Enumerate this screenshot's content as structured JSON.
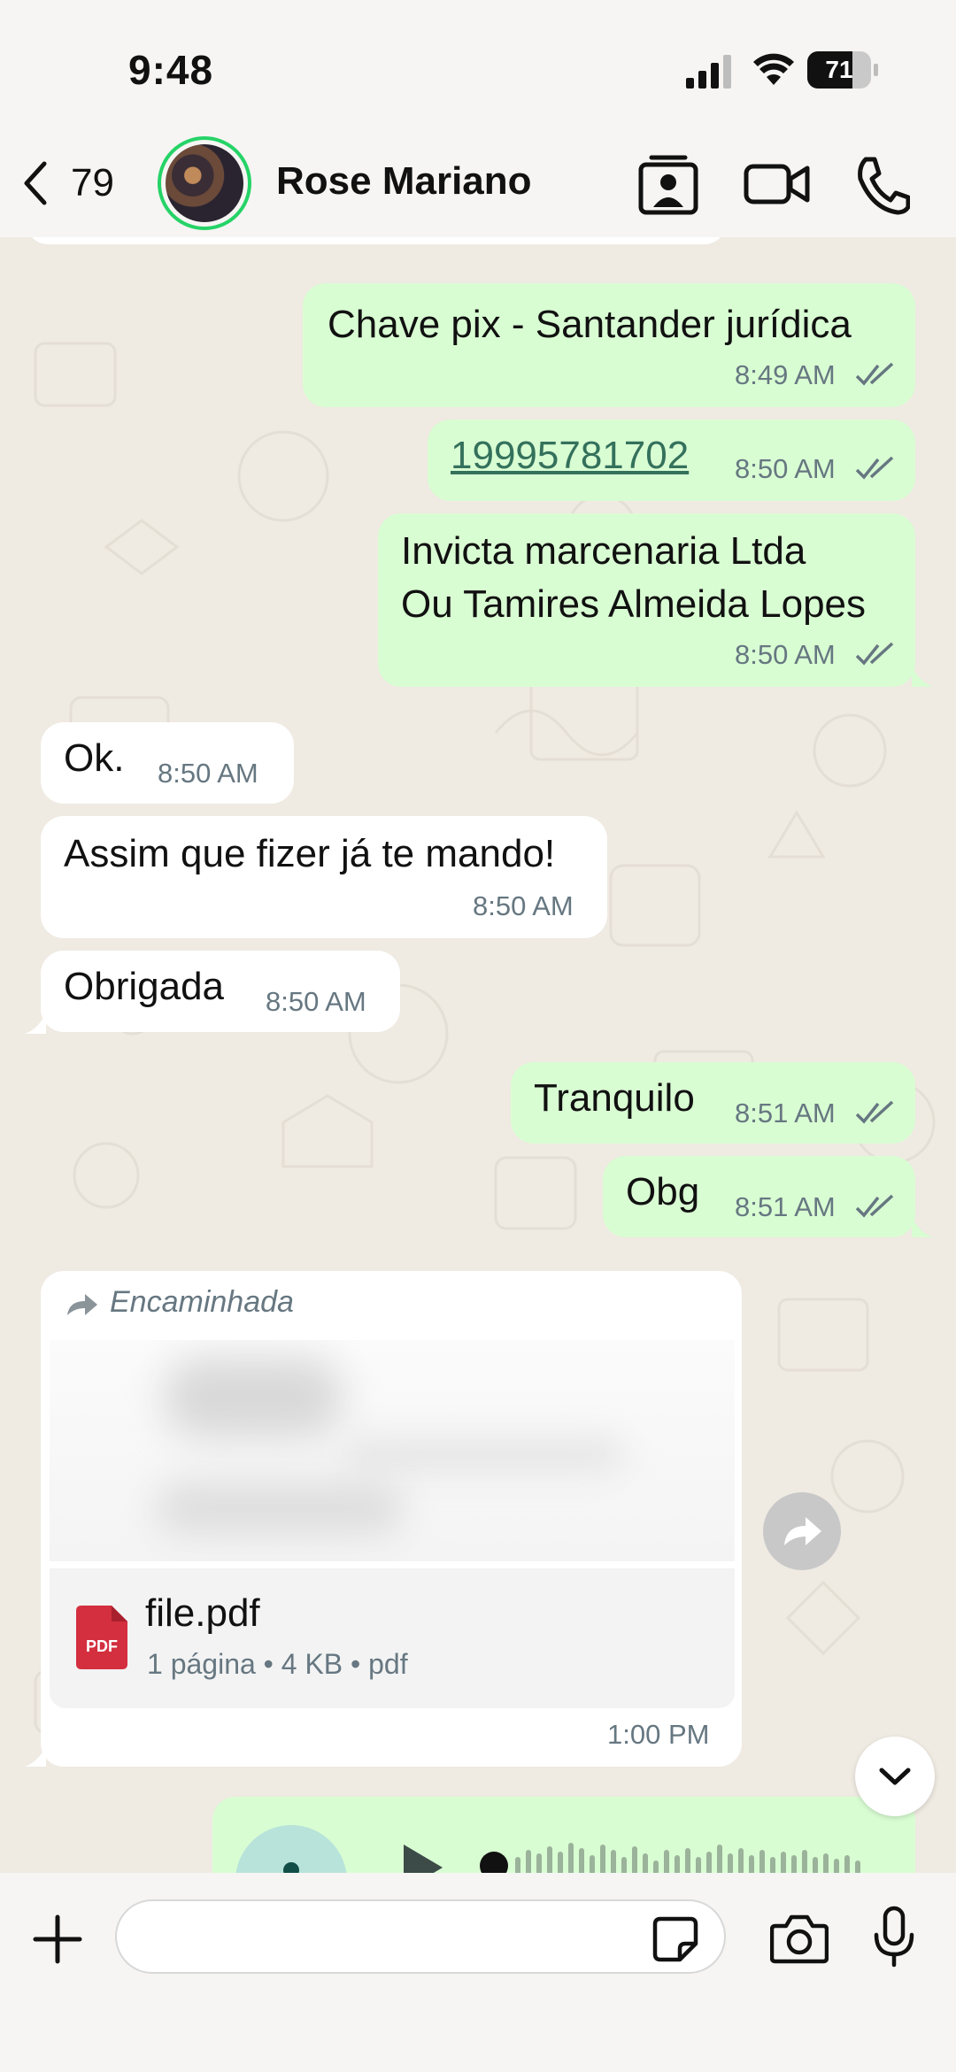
{
  "status_bar": {
    "time": "9:48",
    "battery_level": "71",
    "battery_fraction": 0.71,
    "icons": [
      "cellular-signal-icon",
      "wifi-icon",
      "battery-icon"
    ]
  },
  "header": {
    "back_count": "79",
    "contact_name": "Rose Mariano",
    "icons": [
      "chevron-left-icon",
      "contact-card-icon",
      "video-call-icon",
      "phone-icon"
    ],
    "accent_color": "#25d366"
  },
  "messages": [
    {
      "id": "m1",
      "direction": "outgoing",
      "text": "Chave pix -  Santander jurídica",
      "time": "8:49 AM",
      "read": true
    },
    {
      "id": "m2",
      "direction": "outgoing",
      "text": "19995781702",
      "time": "8:50 AM",
      "read": true,
      "is_link": true
    },
    {
      "id": "m3",
      "direction": "outgoing",
      "lines": [
        "Invicta marcenaria Ltda",
        "Ou Tamires Almeida Lopes"
      ],
      "time": "8:50 AM",
      "read": true
    },
    {
      "id": "m4",
      "direction": "incoming",
      "text": "Ok.",
      "time": "8:50 AM"
    },
    {
      "id": "m5",
      "direction": "incoming",
      "text": "Assim que fizer já te mando!",
      "time": "8:50 AM"
    },
    {
      "id": "m6",
      "direction": "incoming",
      "text": "Obrigada",
      "time": "8:50 AM"
    },
    {
      "id": "m7",
      "direction": "outgoing",
      "text": "Tranquilo",
      "time": "8:51 AM",
      "read": true
    },
    {
      "id": "m8",
      "direction": "outgoing",
      "text": "Obg",
      "time": "8:51 AM",
      "read": true
    },
    {
      "id": "m9",
      "direction": "incoming",
      "forwarded_label": "Encaminhada",
      "file": {
        "name": "file.pdf",
        "meta": "1 página • 4 KB • pdf",
        "type_badge": "PDF"
      },
      "time": "1:00 PM"
    }
  ],
  "colors": {
    "outgoing_bubble": "#d9fdd3",
    "incoming_bubble": "#ffffff",
    "chat_background": "#efeae2",
    "link": "#34715c",
    "read_ticks": "#667781",
    "pdf_red": "#d32f3f"
  },
  "input_bar": {
    "placeholder": "",
    "icons": [
      "plus-icon",
      "sticker-icon",
      "camera-icon",
      "microphone-icon"
    ]
  }
}
